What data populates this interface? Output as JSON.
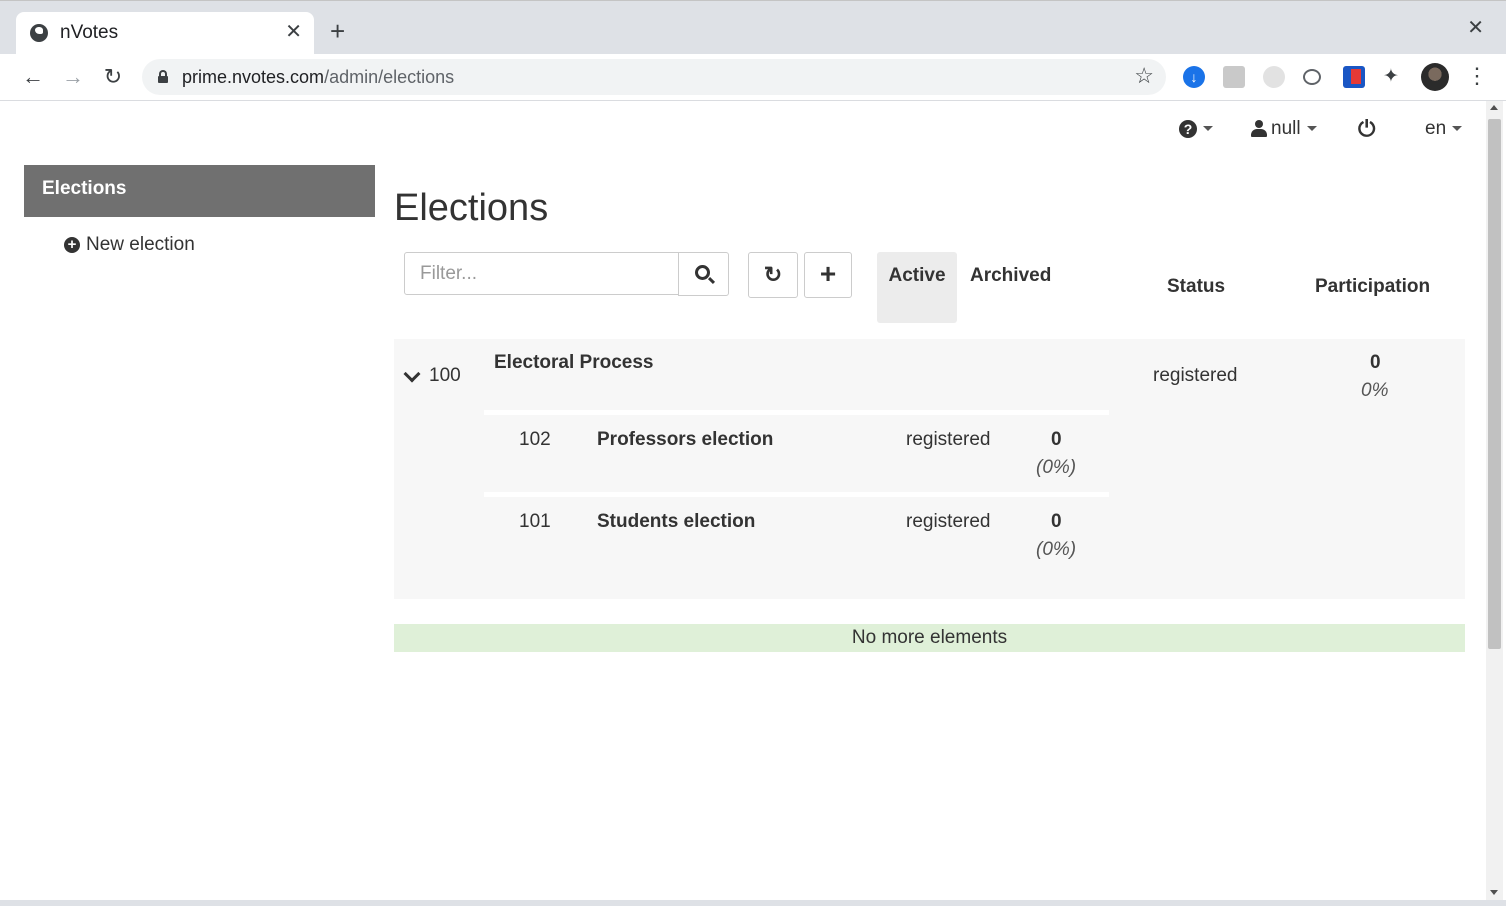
{
  "browser": {
    "tab_title": "nVotes",
    "tab_close": "✕",
    "new_tab": "+",
    "window_close": "✕",
    "url_host": "prime.nvotes.com",
    "url_path": "/admin/elections",
    "icons": [
      "globe-icon",
      "back-icon",
      "forward-icon",
      "reload-icon",
      "lock-icon",
      "star-icon",
      "download-icon",
      "puzzle-icon",
      "kebab-menu-icon"
    ]
  },
  "topbar": {
    "help_label": "?",
    "user_label": "null",
    "language": "en"
  },
  "sidebar": {
    "header": "Elections",
    "new_election": "New election"
  },
  "main": {
    "title": "Elections",
    "filter_placeholder": "Filter...",
    "tabs": [
      {
        "label": "Active",
        "selected": true
      },
      {
        "label": "Archived",
        "selected": false
      }
    ],
    "columns": {
      "status": "Status",
      "participation": "Participation"
    },
    "group": {
      "id": "100",
      "name": "Electoral Process",
      "status": "registered",
      "participation_count": "0",
      "participation_pct": "0%",
      "children": [
        {
          "id": "102",
          "name": "Professors election",
          "status": "registered",
          "participation_count": "0",
          "participation_pct": "(0%)"
        },
        {
          "id": "101",
          "name": "Students election",
          "status": "registered",
          "participation_count": "0",
          "participation_pct": "(0%)"
        }
      ]
    },
    "footer_message": "No more elements"
  },
  "colors": {
    "sidebar_header_bg": "#707070",
    "no_more_bg": "#dff0d8",
    "active_tab_bg": "#ececec",
    "group_bg": "#f7f7f7"
  }
}
